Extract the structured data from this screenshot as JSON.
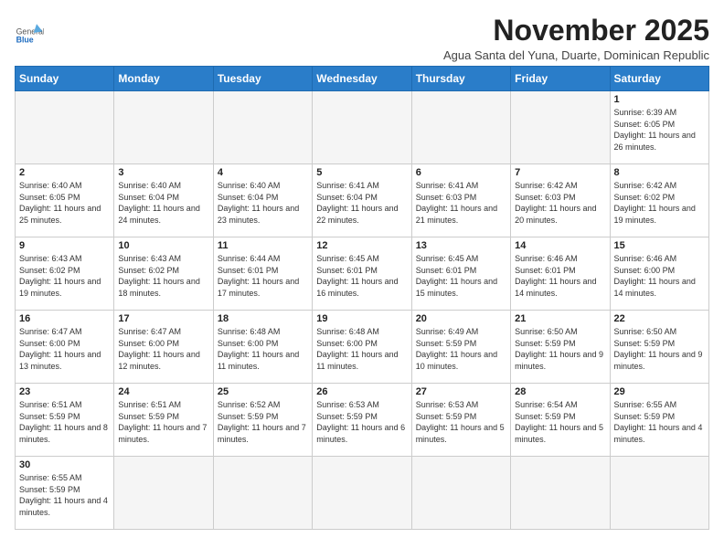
{
  "header": {
    "logo_general": "General",
    "logo_blue": "Blue",
    "month_title": "November 2025",
    "subtitle": "Agua Santa del Yuna, Duarte, Dominican Republic"
  },
  "weekdays": [
    "Sunday",
    "Monday",
    "Tuesday",
    "Wednesday",
    "Thursday",
    "Friday",
    "Saturday"
  ],
  "days": {
    "d1": {
      "num": "1",
      "rise": "6:39 AM",
      "set": "6:05 PM",
      "hours": "11 hours and 26 minutes."
    },
    "d2": {
      "num": "2",
      "rise": "6:40 AM",
      "set": "6:05 PM",
      "hours": "11 hours and 25 minutes."
    },
    "d3": {
      "num": "3",
      "rise": "6:40 AM",
      "set": "6:04 PM",
      "hours": "11 hours and 24 minutes."
    },
    "d4": {
      "num": "4",
      "rise": "6:40 AM",
      "set": "6:04 PM",
      "hours": "11 hours and 23 minutes."
    },
    "d5": {
      "num": "5",
      "rise": "6:41 AM",
      "set": "6:04 PM",
      "hours": "11 hours and 22 minutes."
    },
    "d6": {
      "num": "6",
      "rise": "6:41 AM",
      "set": "6:03 PM",
      "hours": "11 hours and 21 minutes."
    },
    "d7": {
      "num": "7",
      "rise": "6:42 AM",
      "set": "6:03 PM",
      "hours": "11 hours and 20 minutes."
    },
    "d8": {
      "num": "8",
      "rise": "6:42 AM",
      "set": "6:02 PM",
      "hours": "11 hours and 19 minutes."
    },
    "d9": {
      "num": "9",
      "rise": "6:43 AM",
      "set": "6:02 PM",
      "hours": "11 hours and 19 minutes."
    },
    "d10": {
      "num": "10",
      "rise": "6:43 AM",
      "set": "6:02 PM",
      "hours": "11 hours and 18 minutes."
    },
    "d11": {
      "num": "11",
      "rise": "6:44 AM",
      "set": "6:01 PM",
      "hours": "11 hours and 17 minutes."
    },
    "d12": {
      "num": "12",
      "rise": "6:45 AM",
      "set": "6:01 PM",
      "hours": "11 hours and 16 minutes."
    },
    "d13": {
      "num": "13",
      "rise": "6:45 AM",
      "set": "6:01 PM",
      "hours": "11 hours and 15 minutes."
    },
    "d14": {
      "num": "14",
      "rise": "6:46 AM",
      "set": "6:01 PM",
      "hours": "11 hours and 14 minutes."
    },
    "d15": {
      "num": "15",
      "rise": "6:46 AM",
      "set": "6:00 PM",
      "hours": "11 hours and 14 minutes."
    },
    "d16": {
      "num": "16",
      "rise": "6:47 AM",
      "set": "6:00 PM",
      "hours": "11 hours and 13 minutes."
    },
    "d17": {
      "num": "17",
      "rise": "6:47 AM",
      "set": "6:00 PM",
      "hours": "11 hours and 12 minutes."
    },
    "d18": {
      "num": "18",
      "rise": "6:48 AM",
      "set": "6:00 PM",
      "hours": "11 hours and 11 minutes."
    },
    "d19": {
      "num": "19",
      "rise": "6:48 AM",
      "set": "6:00 PM",
      "hours": "11 hours and 11 minutes."
    },
    "d20": {
      "num": "20",
      "rise": "6:49 AM",
      "set": "5:59 PM",
      "hours": "11 hours and 10 minutes."
    },
    "d21": {
      "num": "21",
      "rise": "6:50 AM",
      "set": "5:59 PM",
      "hours": "11 hours and 9 minutes."
    },
    "d22": {
      "num": "22",
      "rise": "6:50 AM",
      "set": "5:59 PM",
      "hours": "11 hours and 9 minutes."
    },
    "d23": {
      "num": "23",
      "rise": "6:51 AM",
      "set": "5:59 PM",
      "hours": "11 hours and 8 minutes."
    },
    "d24": {
      "num": "24",
      "rise": "6:51 AM",
      "set": "5:59 PM",
      "hours": "11 hours and 7 minutes."
    },
    "d25": {
      "num": "25",
      "rise": "6:52 AM",
      "set": "5:59 PM",
      "hours": "11 hours and 7 minutes."
    },
    "d26": {
      "num": "26",
      "rise": "6:53 AM",
      "set": "5:59 PM",
      "hours": "11 hours and 6 minutes."
    },
    "d27": {
      "num": "27",
      "rise": "6:53 AM",
      "set": "5:59 PM",
      "hours": "11 hours and 5 minutes."
    },
    "d28": {
      "num": "28",
      "rise": "6:54 AM",
      "set": "5:59 PM",
      "hours": "11 hours and 5 minutes."
    },
    "d29": {
      "num": "29",
      "rise": "6:55 AM",
      "set": "5:59 PM",
      "hours": "11 hours and 4 minutes."
    },
    "d30": {
      "num": "30",
      "rise": "6:55 AM",
      "set": "5:59 PM",
      "hours": "11 hours and 4 minutes."
    }
  }
}
